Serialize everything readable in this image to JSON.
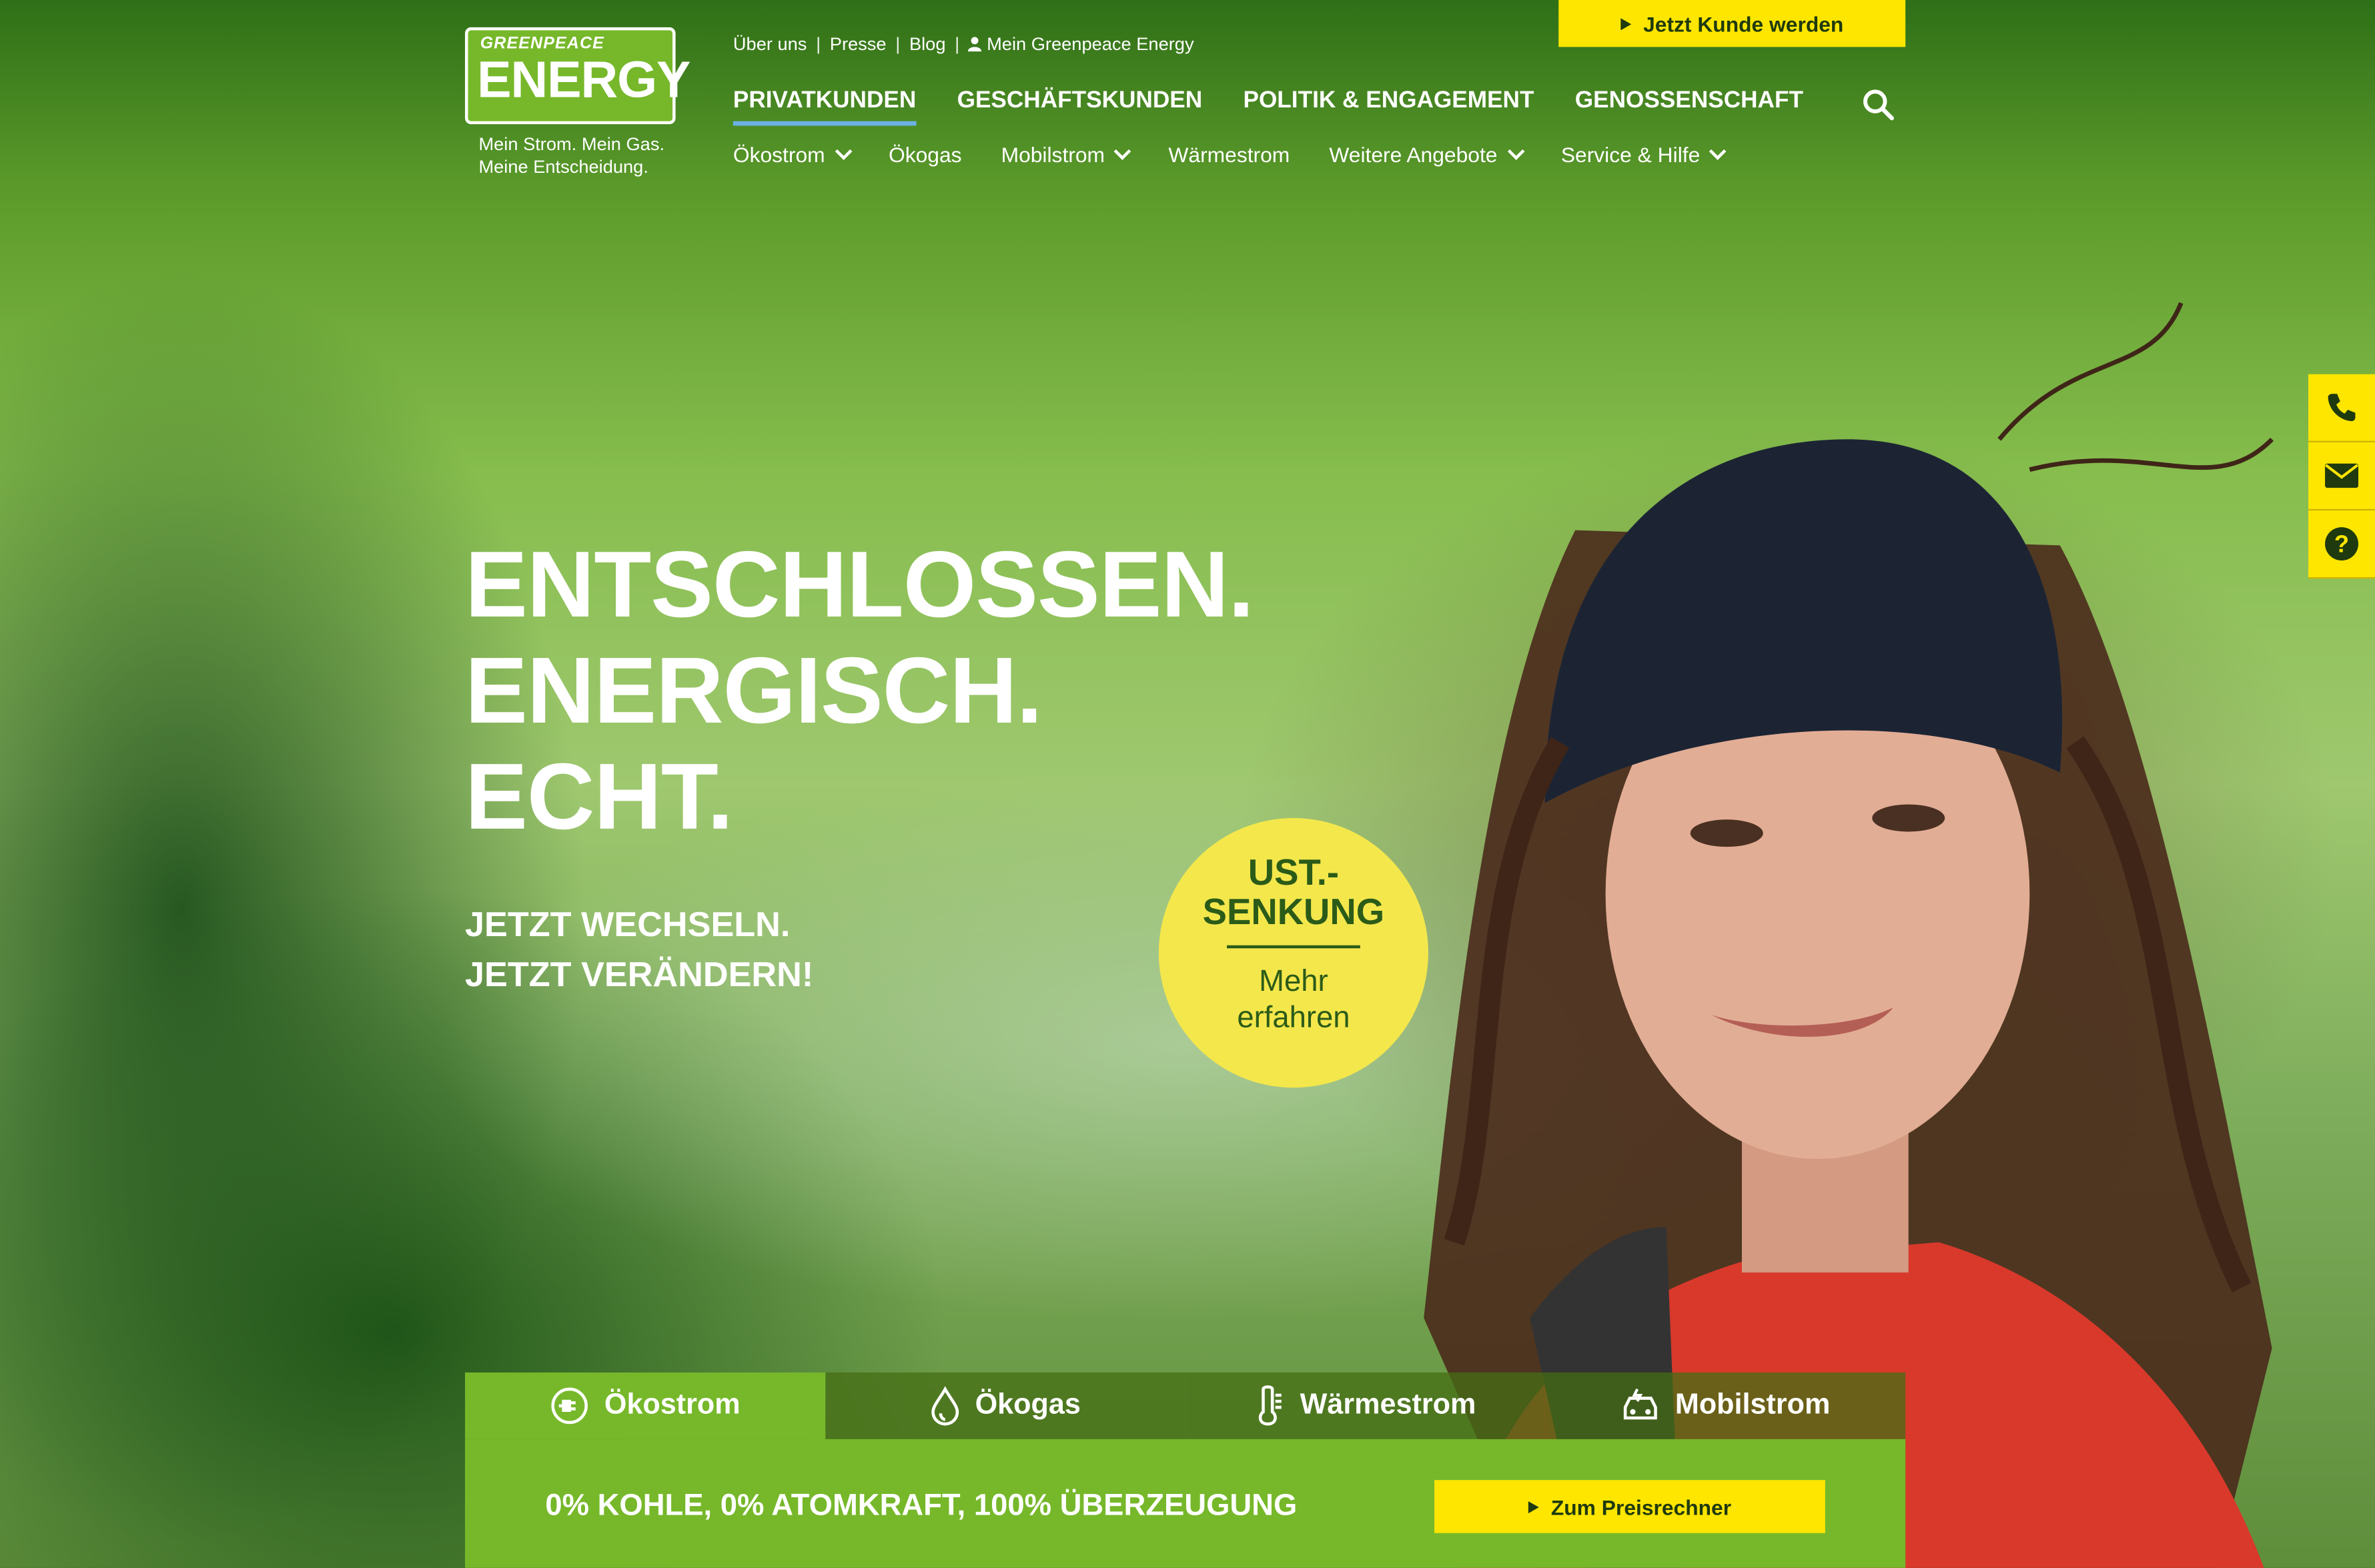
{
  "brand": {
    "logo_small": "GREENPEACE",
    "logo_big": "ENERGY",
    "tagline_line1": "Mein Strom. Mein Gas.",
    "tagline_line2": "Meine Entscheidung."
  },
  "top_links": {
    "about": "Über uns",
    "press": "Presse",
    "blog": "Blog",
    "account": "Mein Greenpeace Energy",
    "separator": "|"
  },
  "top_cta": "Jetzt Kunde werden",
  "main_nav": [
    "PRIVATKUNDEN",
    "GESCHÄFTSKUNDEN",
    "POLITIK & ENGAGEMENT",
    "GENOSSENSCHAFT"
  ],
  "sub_nav": [
    {
      "label": "Ökostrom",
      "dropdown": true
    },
    {
      "label": "Ökogas",
      "dropdown": false
    },
    {
      "label": "Mobilstrom",
      "dropdown": true
    },
    {
      "label": "Wärmestrom",
      "dropdown": false
    },
    {
      "label": "Weitere Angebote",
      "dropdown": true
    },
    {
      "label": "Service & Hilfe",
      "dropdown": true
    }
  ],
  "hero": {
    "line1": "ENTSCHLOSSEN.",
    "line2": "ENERGISCH.",
    "line3": "ECHT.",
    "sub1": "JETZT WECHSELN.",
    "sub2": "JETZT VERÄNDERN!"
  },
  "badge": {
    "title1": "UST.-",
    "title2": "SENKUNG",
    "more1": "Mehr",
    "more2": "erfahren"
  },
  "side_icons": [
    "phone-icon",
    "mail-icon",
    "help-icon"
  ],
  "tabs": [
    {
      "label": "Ökostrom",
      "icon": "plug-icon"
    },
    {
      "label": "Ökogas",
      "icon": "flame-icon"
    },
    {
      "label": "Wärmestrom",
      "icon": "thermometer-icon"
    },
    {
      "label": "Mobilstrom",
      "icon": "car-icon"
    }
  ],
  "panel": {
    "claim": "0% KOHLE, 0% ATOMKRAFT, 100% ÜBERZEUGUNG",
    "cta": "Zum Preisrechner"
  },
  "colors": {
    "brand_green": "#76b82a",
    "cta_yellow": "#ffe600",
    "badge_yellow": "#f4e74c",
    "active_underline": "#6ab1e4"
  }
}
